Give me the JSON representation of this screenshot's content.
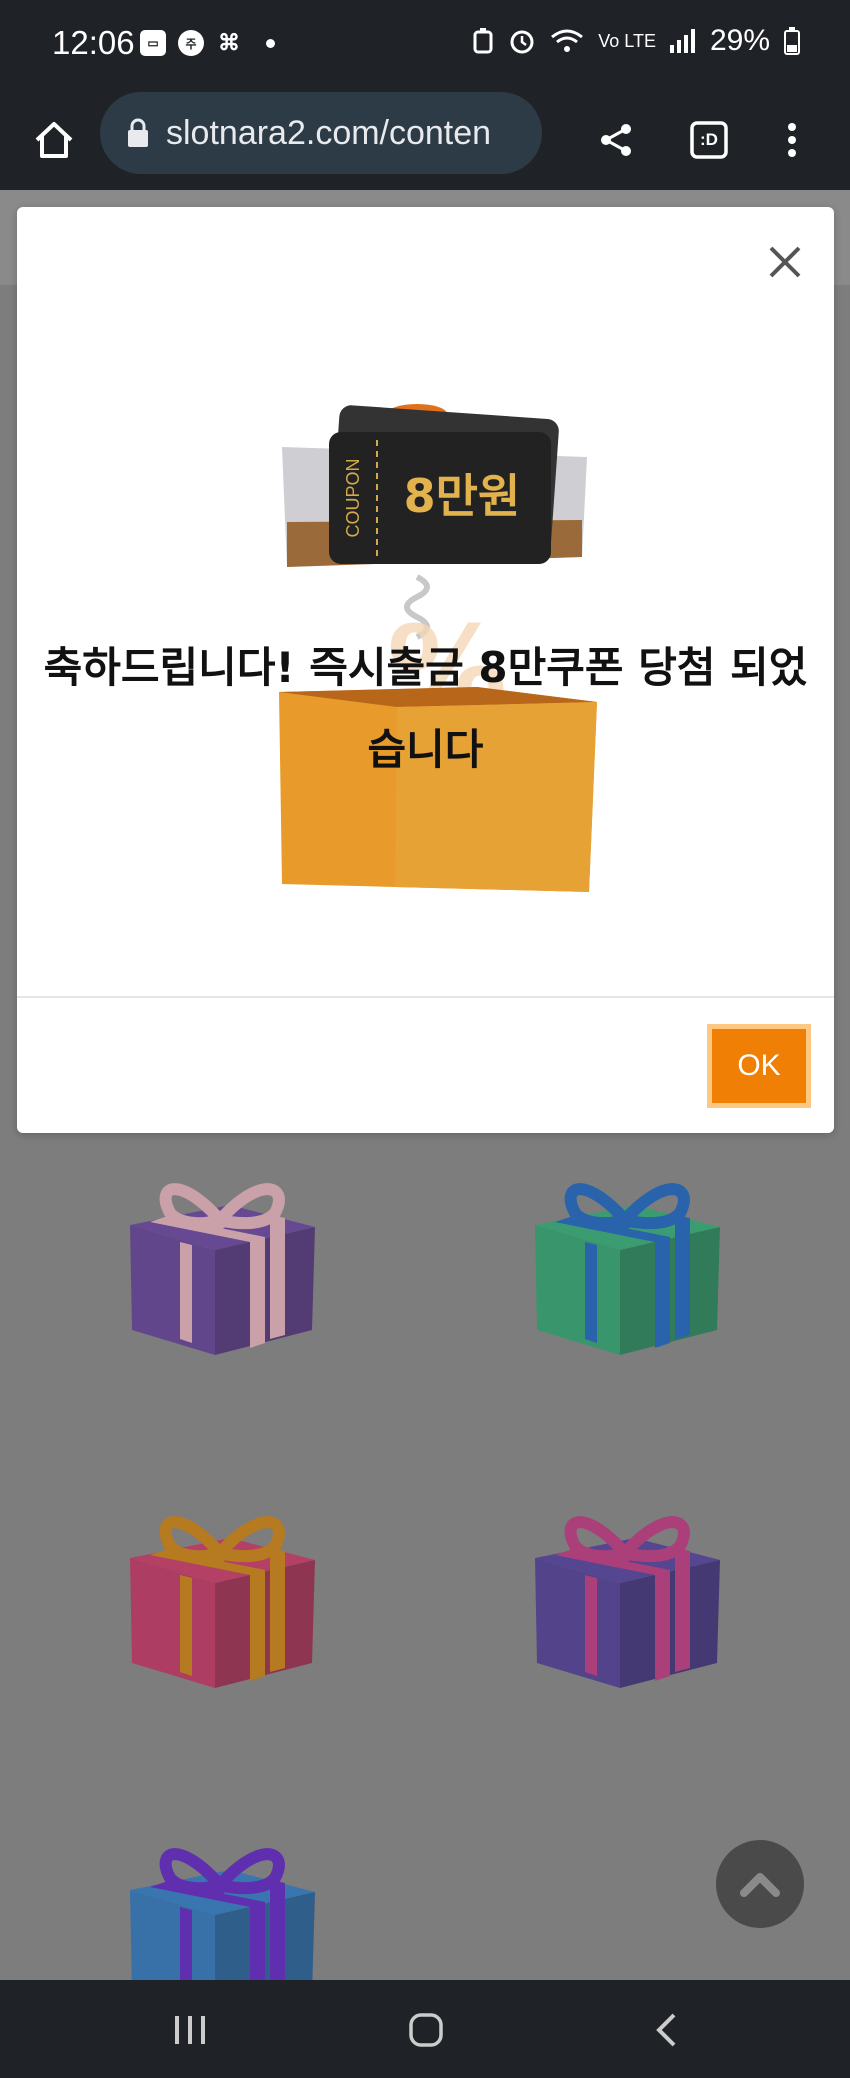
{
  "status_bar": {
    "time": "12:06",
    "notif_icons": [
      "gallery-icon",
      "order-icon",
      "app-icon"
    ],
    "network_label": "Vo LTE",
    "battery": "29%"
  },
  "browser": {
    "url": "slotnara2.com/conten",
    "tab_count": ":D"
  },
  "modal": {
    "coupon_label": "COUPON",
    "coupon_value": "8만원",
    "message": "축하드립니다! 즉시출금 8만쿠폰 당첨 되었습니다",
    "ok_label": "OK"
  },
  "gifts": [
    {
      "box": "#5e3d8f",
      "ribbon": "#d8a8b0"
    },
    {
      "box": "#2e9a6a",
      "ribbon": "#1a5fb4"
    },
    {
      "box": "#b6335e",
      "ribbon": "#c07a10"
    },
    {
      "box": "#4b3a8e",
      "ribbon": "#b3357a"
    },
    {
      "box": "#2c6fb0",
      "ribbon": "#5b22b8"
    }
  ],
  "colors": {
    "ok_button": "#f07f06",
    "system_bar": "#1f2328",
    "overlay": "#7d7d7d"
  }
}
